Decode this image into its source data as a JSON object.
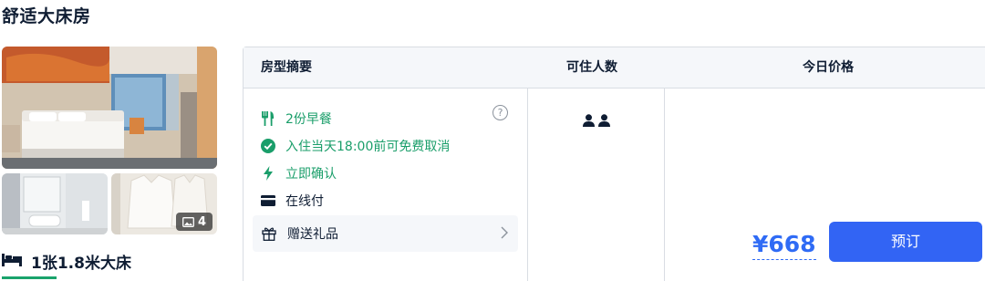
{
  "room": {
    "title": "舒适大床房",
    "photo_count": "4",
    "bed": "1张1.8米大床"
  },
  "table": {
    "headers": {
      "room_summary": "房型摘要",
      "guests": "可住人数",
      "today_price": "今日价格"
    },
    "features": {
      "breakfast": "2份早餐",
      "cancellation": "入住当天18:00前可免费取消",
      "instant_confirm": "立即确认",
      "pay_online": "在线付",
      "gift": "赠送礼品"
    },
    "guest_count": 2,
    "price": "¥668",
    "book_label": "预订"
  },
  "colors": {
    "green": "#1a9e6a",
    "blue": "#3264f4",
    "price_blue": "#2f6bf5"
  }
}
